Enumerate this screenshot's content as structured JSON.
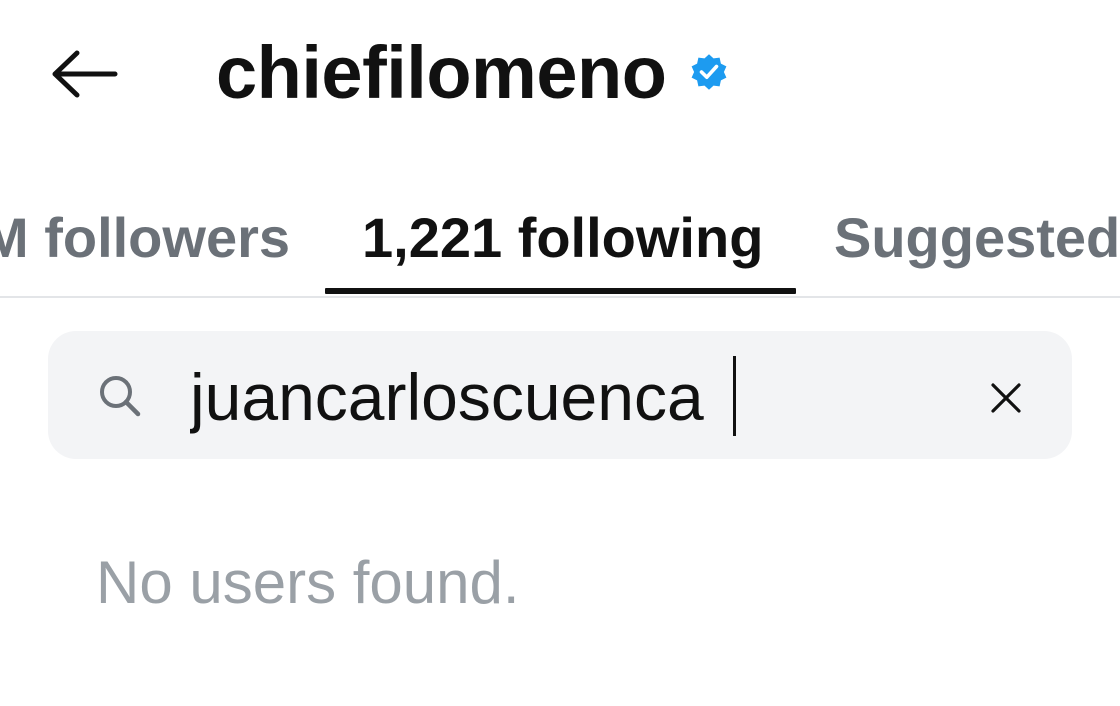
{
  "header": {
    "back_icon": "arrow-left-icon",
    "title": "chiefilomeno",
    "verified_icon": "verified-badge-icon",
    "verified_color": "#1d9bf0"
  },
  "tabs": [
    {
      "label": "M followers",
      "active": false
    },
    {
      "label": "1,221 following",
      "active": true
    },
    {
      "label": "Suggested",
      "active": false
    }
  ],
  "search": {
    "icon": "search-icon",
    "value": "juancarloscuenca",
    "clear_icon": "close-icon"
  },
  "results": {
    "empty_message": "No users found."
  },
  "colors": {
    "text_primary": "#111111",
    "text_secondary": "#6b7178",
    "text_muted": "#9aa0a6",
    "search_bg": "#f3f4f6",
    "divider": "#e3e5e8"
  }
}
